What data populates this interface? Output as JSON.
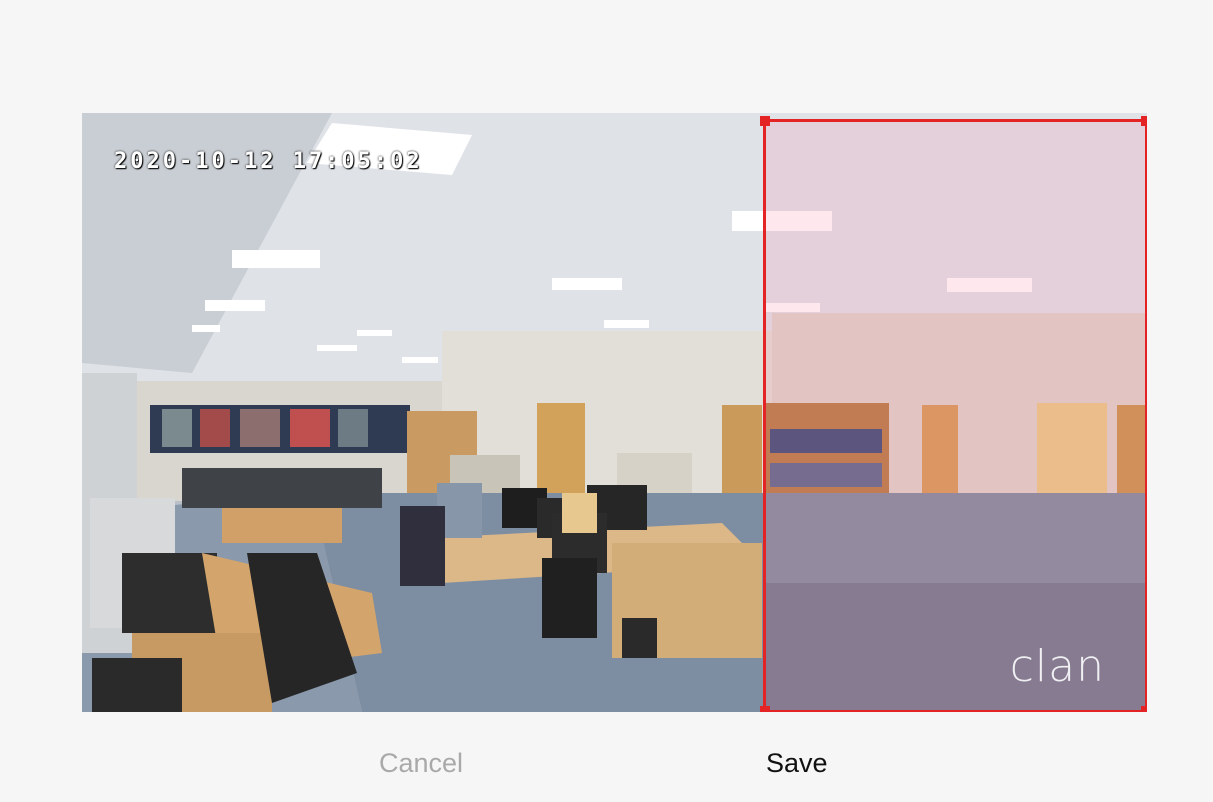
{
  "camera": {
    "timestamp": "2020-10-12 17:05:02",
    "watermark": "clan"
  },
  "roi": {
    "border_color": "#e42424"
  },
  "actions": {
    "cancel_label": "Cancel",
    "save_label": "Save"
  },
  "colors": {
    "background": "#f6f6f6",
    "cancel_text": "#a9a9a9",
    "save_text": "#111111"
  }
}
